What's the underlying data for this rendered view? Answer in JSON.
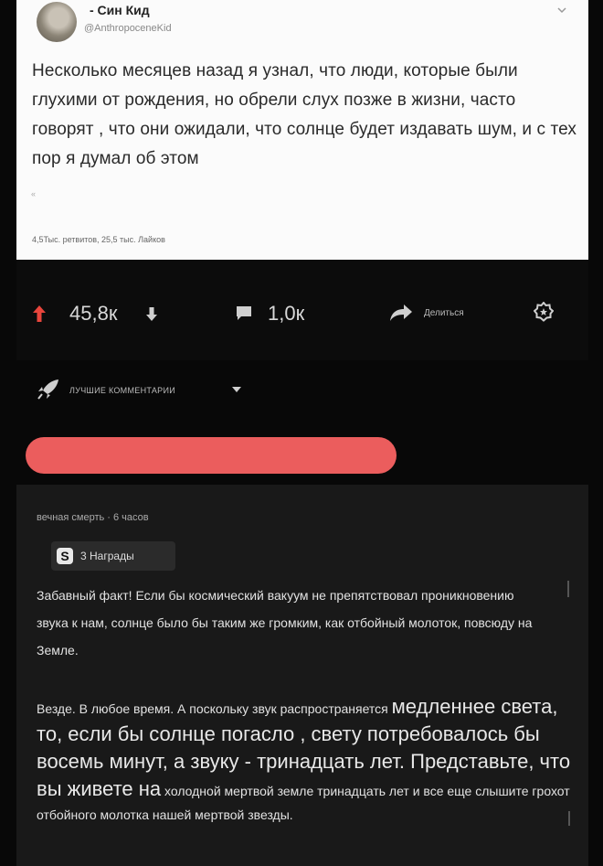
{
  "tweet": {
    "author_name": "- Син Кид",
    "author_handle": "@AnthropoceneKid",
    "text": "Несколько месяцев назад я узнал, что люди, которые были глухими от рождения, но обрели слух позже в жизни, часто говорят , что они ожидали, что солнце будет издавать шум, и с тех пор я думал об этом",
    "mark": "«",
    "stats": "4,5Тыс. ретвитов, 25,5 тыс. Лайков"
  },
  "actions": {
    "votes": "45,8к",
    "comments": "1,0к",
    "share_label": "Делиться"
  },
  "sort": {
    "label": "ЛУЧШИЕ КОММЕНТАРИИ"
  },
  "comment": {
    "meta": "вечная смерть · 6 часов",
    "awards_icon": "S",
    "awards_label": "3 Награды",
    "paragraph1": "Забавный факт! Если бы космический вакуум не препятствовал проникновению звука к нам, солнце было бы таким же громким, как отбойный молоток, повсюду на Земле.",
    "p2_start": "Везде. В любое время. А поскольку звук распространяется",
    "p2_big": "медленнее света, то, если бы солнце погасло , свету потребовалось бы восемь минут, а звуку - тринадцать лет. Представьте, что вы живете на",
    "p2_end": "холодной мертвой земле тринадцать лет и все еще слышите грохот отбойного молотка нашей мертвой звезды."
  },
  "colors": {
    "upvote": "#e8453c",
    "redaction": "#eb5d5d",
    "background": "#080808",
    "comment_bg": "#191919"
  },
  "icons": [
    "chevron-down-icon",
    "upvote-arrow-icon",
    "downvote-arrow-icon",
    "comment-icon",
    "share-icon",
    "award-icon",
    "rocket-icon",
    "awards-badge-icon"
  ]
}
